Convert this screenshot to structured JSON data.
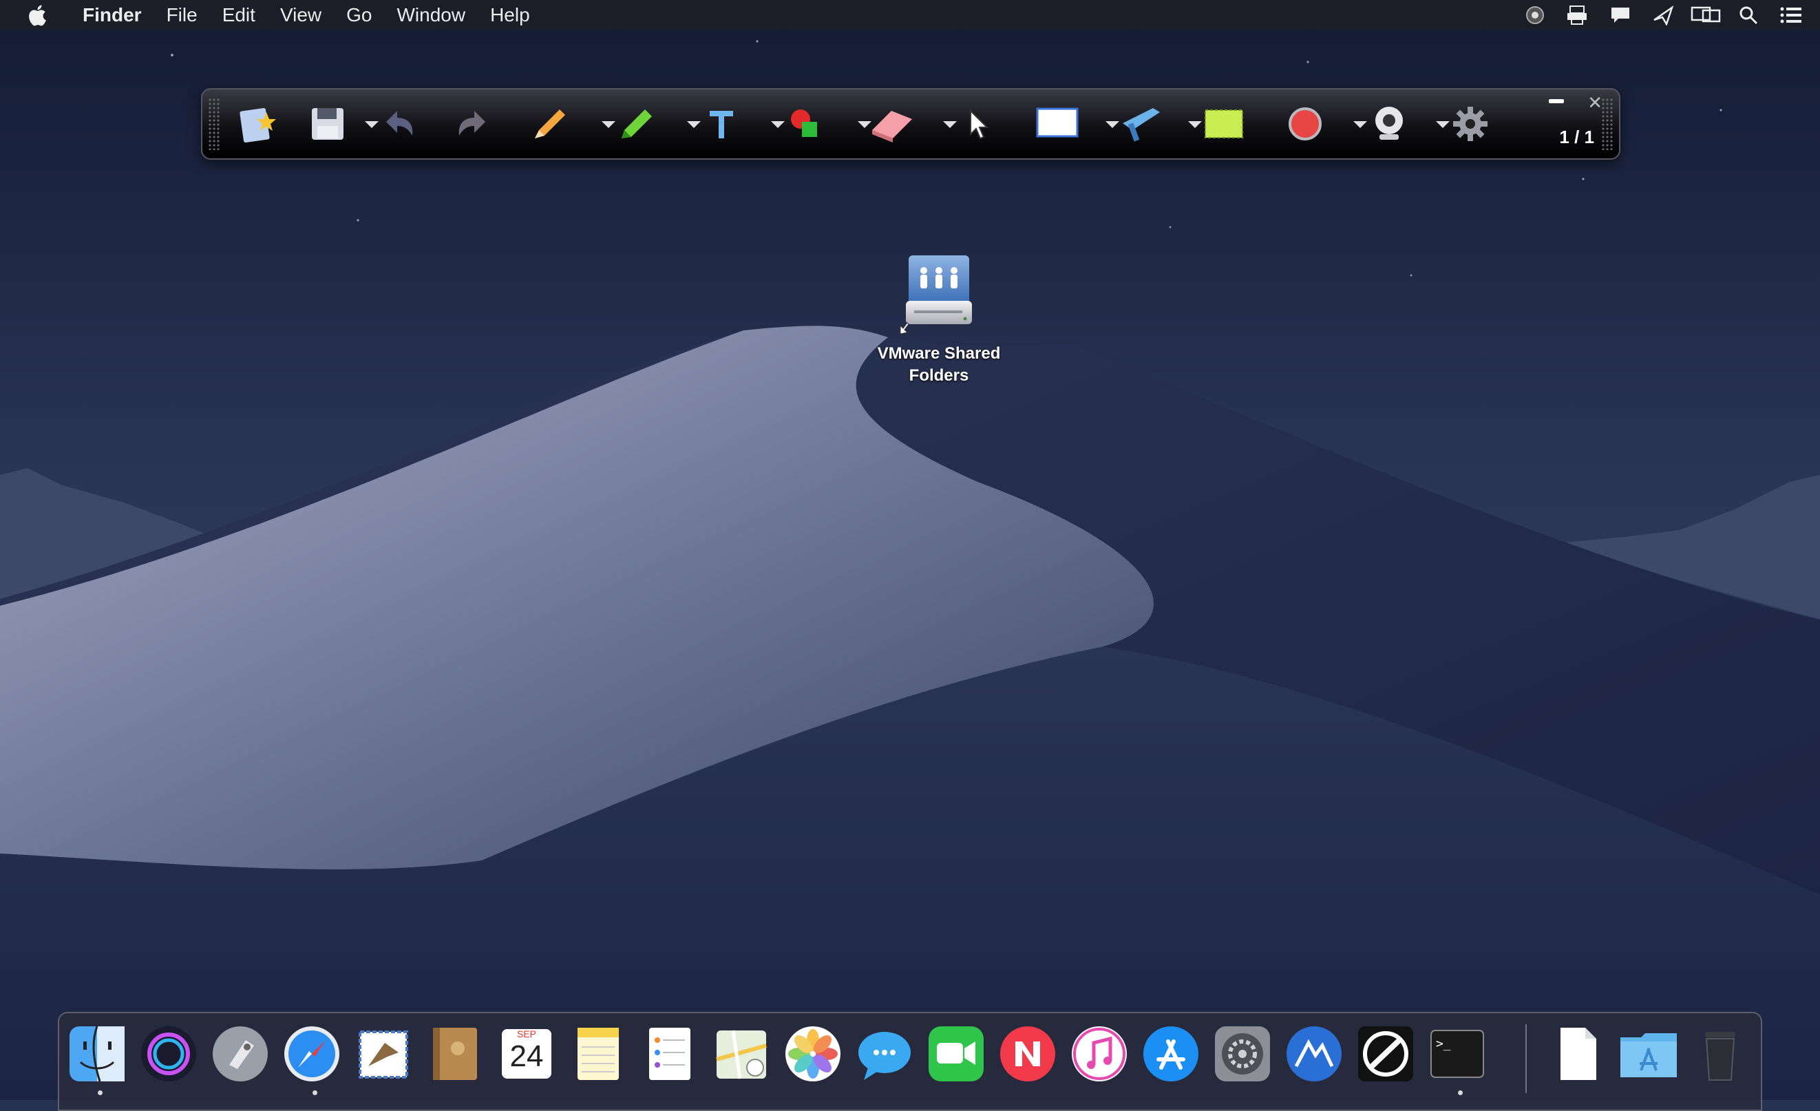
{
  "menubar": {
    "app_name": "Finder",
    "menus": [
      "File",
      "Edit",
      "View",
      "Go",
      "Window",
      "Help"
    ],
    "status_icons": [
      "vmware-tools-icon",
      "printer-icon",
      "messages-icon",
      "airplay-icon",
      "display-icon",
      "spotlight-search-icon",
      "notification-center-icon"
    ]
  },
  "toolbar": {
    "page_counter": "1 / 1",
    "tools": [
      "new-page-icon",
      "save-icon",
      "undo-icon",
      "redo-icon",
      "pencil-icon",
      "highlighter-icon",
      "text-icon",
      "shapes-icon",
      "eraser-icon",
      "cursor-icon",
      "whiteboard-icon",
      "line-tool-icon",
      "rectangle-fill-icon",
      "record-icon",
      "webcam-icon",
      "settings-gear-icon"
    ]
  },
  "desktop": {
    "icon_label": "VMware Shared Folders"
  },
  "dock": {
    "apps": [
      "finder-icon",
      "siri-icon",
      "launchpad-icon",
      "safari-icon",
      "mail-icon",
      "contacts-icon",
      "calendar-icon",
      "notes-icon",
      "reminders-icon",
      "maps-icon",
      "photos-icon",
      "messages-icon",
      "facetime-icon",
      "news-icon",
      "itunes-icon",
      "app-store-icon",
      "system-preferences-icon",
      "affinity-icon",
      "screen-annotation-icon",
      "terminal-icon",
      "document-icon",
      "applications-folder-icon",
      "trash-icon"
    ],
    "calendar_month": "SEP",
    "calendar_day": "24",
    "terminal_prompt": ">_"
  },
  "colors": {
    "sky": "#1b2440",
    "dune_light": "#8b93b0",
    "dune_dark": "#1f2845",
    "toolbar_bg": "#111115"
  }
}
